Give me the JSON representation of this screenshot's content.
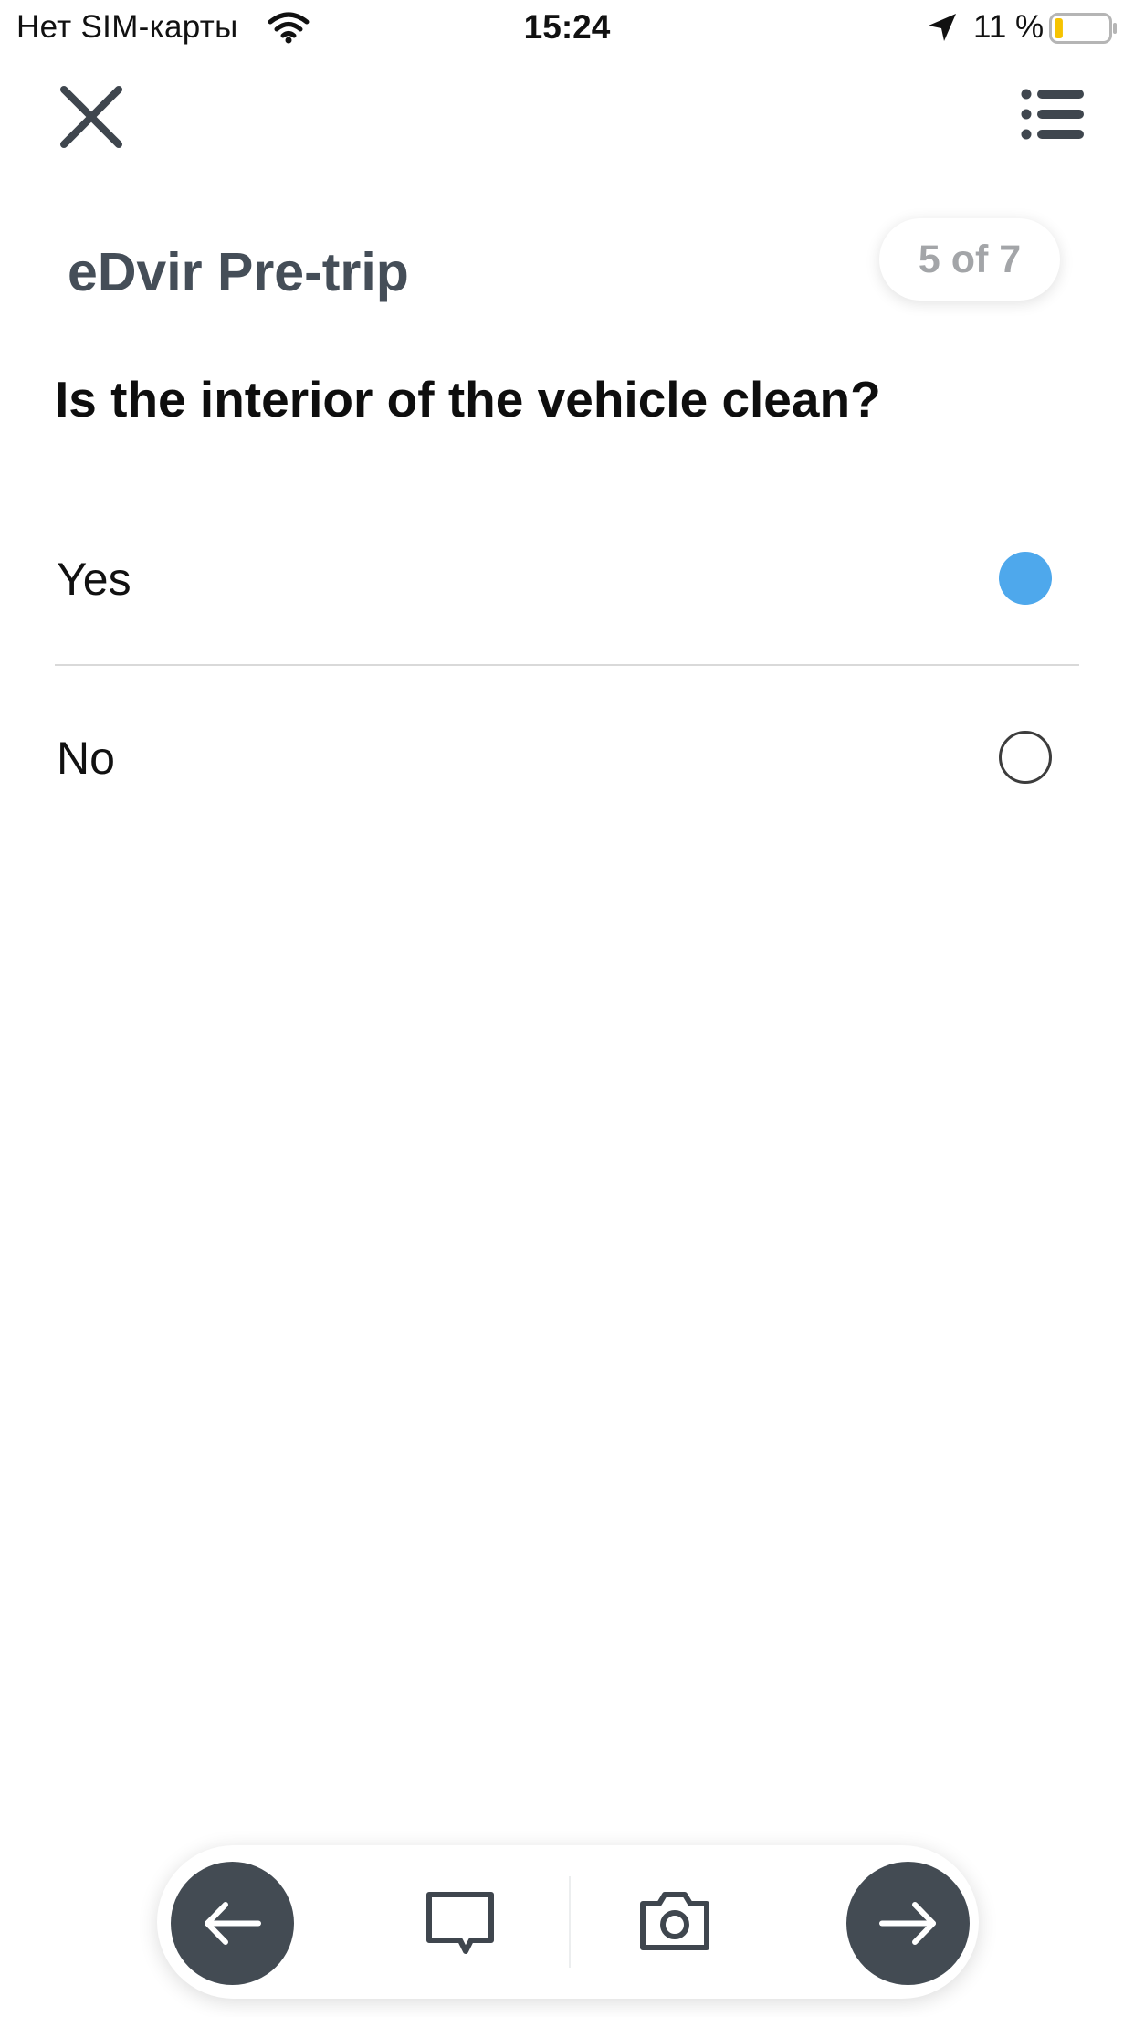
{
  "status_bar": {
    "carrier": "Нет SIM-карты",
    "time": "15:24",
    "battery_percent": "11 %",
    "battery_level": 0.11,
    "battery_color": "#f6c300"
  },
  "header": {
    "close_icon": "close-icon",
    "menu_icon": "list-menu-icon"
  },
  "form": {
    "title": "eDvir Pre-trip",
    "progress": "5 of 7",
    "question": "Is the interior of the vehicle clean?",
    "options": [
      {
        "label": "Yes",
        "selected": true
      },
      {
        "label": "No",
        "selected": false
      }
    ],
    "selected_color": "#4ea8ec"
  },
  "toolbar": {
    "back_icon": "arrow-left-icon",
    "comment_icon": "comment-icon",
    "camera_icon": "camera-icon",
    "next_icon": "arrow-right-icon",
    "button_color": "#434b53"
  }
}
